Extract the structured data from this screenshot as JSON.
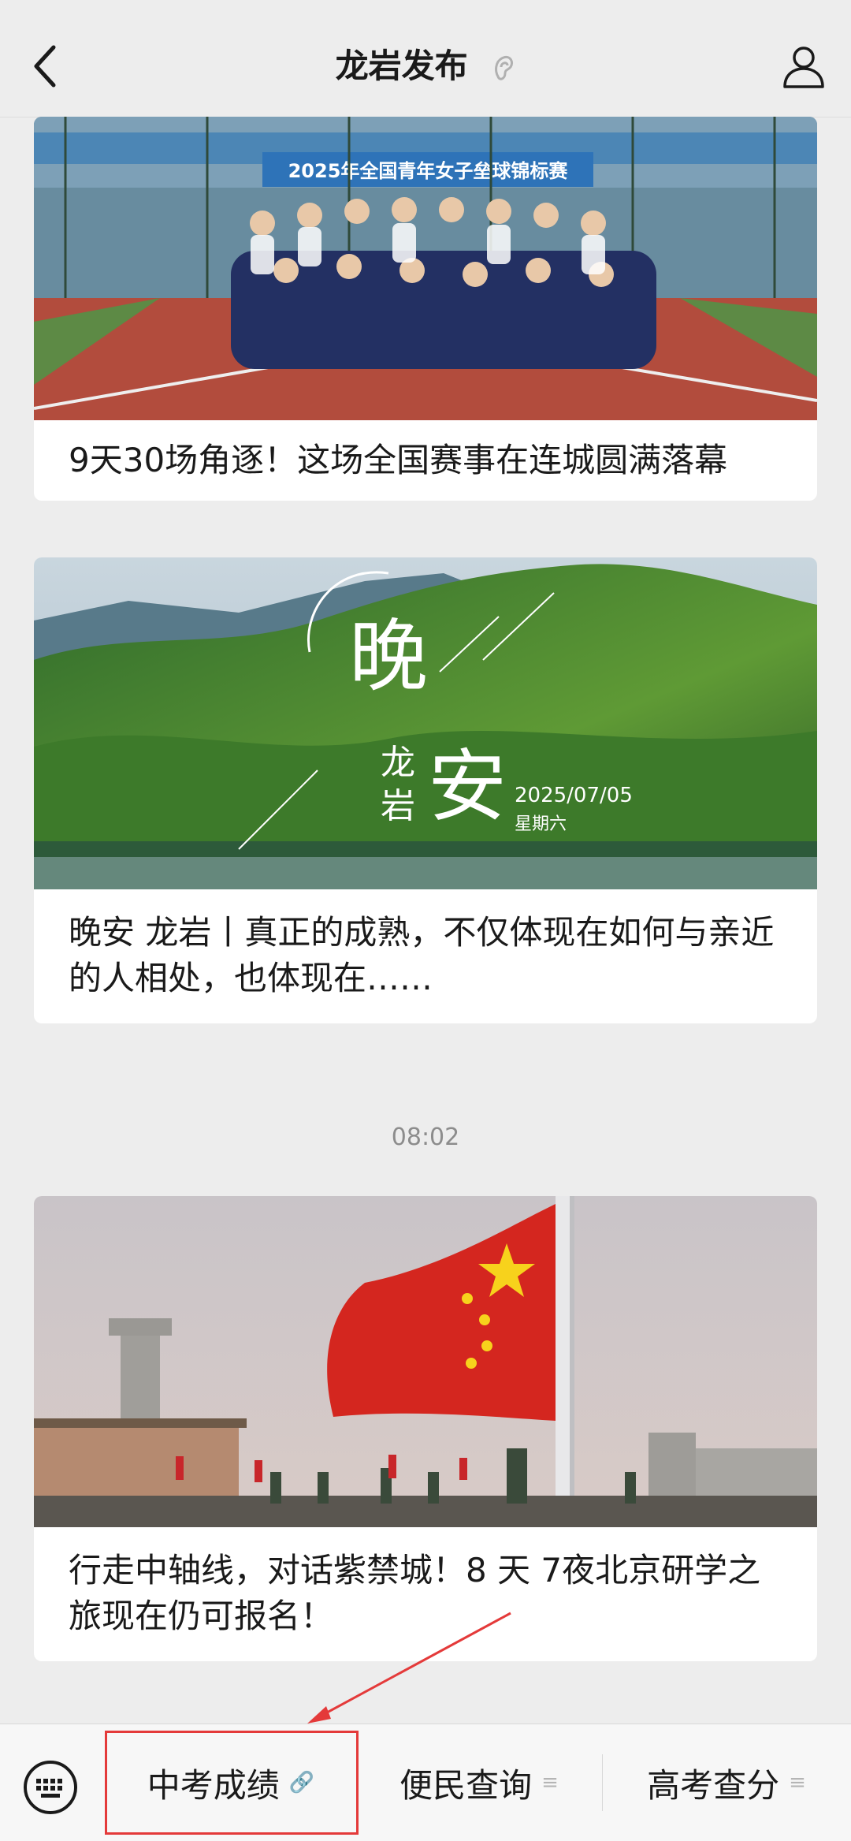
{
  "header": {
    "title": "龙岩发布",
    "back_icon": "chevron-left-icon",
    "ear_icon": "ear-icon",
    "profile_icon": "person-icon"
  },
  "articles": [
    {
      "title": "9天30场角逐！这场全国赛事在连城圆满落幕",
      "banner_text": "2025年全国青年女子垒球锦标赛"
    },
    {
      "title": "晚安 龙岩丨真正的成熟，不仅体现在如何与亲近的人相处，也体现在……",
      "overlay": {
        "big_char_1": "晚",
        "small_chars": [
          "龙",
          "岩"
        ],
        "big_char_2": "安",
        "date": "2025/07/05",
        "weekday": "星期六"
      }
    },
    {
      "title": "行走中轴线，对话紫禁城！8 天 7夜北京研学之旅现在仍可报名！"
    }
  ],
  "timestamp": "08:02",
  "bottom_menu": {
    "keyboard_icon": "keyboard-icon",
    "items": [
      {
        "label": "中考成绩",
        "suffix": "🔗"
      },
      {
        "label": "便民查询",
        "suffix": "≡"
      },
      {
        "label": "高考查分",
        "suffix": "≡"
      }
    ]
  },
  "colors": {
    "accent_red": "#e43a3a",
    "background": "#ededed"
  }
}
